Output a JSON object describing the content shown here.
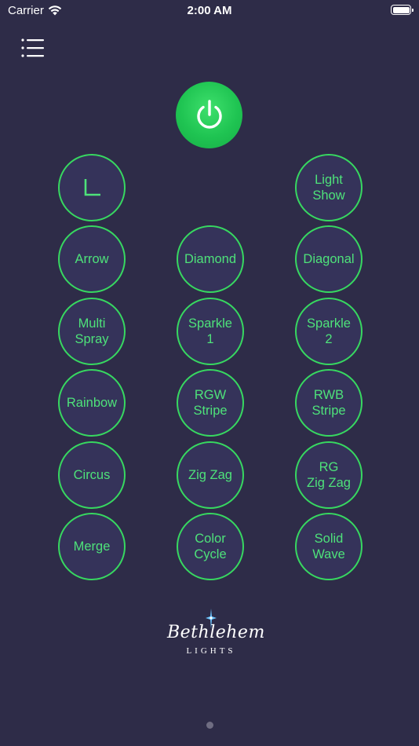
{
  "status_bar": {
    "carrier": "Carrier",
    "time": "2:00 AM"
  },
  "icons": {
    "menu": "menu-list-icon",
    "power": "power-icon",
    "wifi": "wifi-icon",
    "battery": "battery-icon",
    "timer": "timer-l-icon",
    "logo_star": "star-icon"
  },
  "colors": {
    "background": "#2e2c48",
    "button_fill": "#35335a",
    "accent_green": "#37d860",
    "label_green": "#4ee27a",
    "power_green": "#1fc452"
  },
  "modes": {
    "light_show": "Light\nShow",
    "arrow": "Arrow",
    "diamond": "Diamond",
    "diagonal": "Diagonal",
    "multi_spray": "Multi\nSpray",
    "sparkle_1": "Sparkle\n1",
    "sparkle_2": "Sparkle\n2",
    "rainbow": "Rainbow",
    "rgw_stripe": "RGW\nStripe",
    "rwb_stripe": "RWB\nStripe",
    "circus": "Circus",
    "zig_zag": "Zig Zag",
    "rg_zig_zag": "RG\nZig Zag",
    "merge": "Merge",
    "color_cycle": "Color\nCycle",
    "solid_wave": "Solid\nWave"
  },
  "logo": {
    "script": "Bethlehem",
    "sub": "LIGHTS"
  },
  "pager": {
    "page_count": 1,
    "current_page": 1
  }
}
